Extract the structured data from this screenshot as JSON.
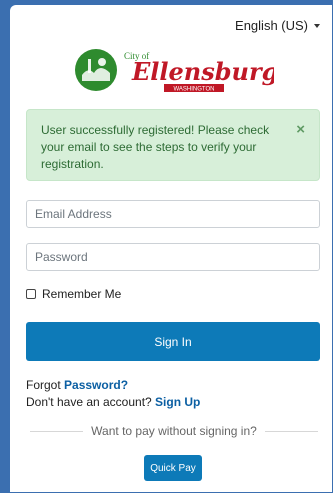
{
  "language": {
    "label": "English (US)"
  },
  "logo": {
    "small_text": "City of",
    "name": "Ellensburg",
    "state": "WASHINGTON",
    "colors": {
      "green": "#2e8b2e",
      "red": "#c01826"
    }
  },
  "alert": {
    "message": "User successfully registered! Please check your email to see the steps to verify your registration.",
    "close_symbol": "×"
  },
  "form": {
    "email_placeholder": "Email Address",
    "password_placeholder": "Password",
    "remember_label": "Remember Me",
    "signin_label": "Sign In"
  },
  "links": {
    "forgot_prefix": "Forgot ",
    "forgot_link": "Password?",
    "signup_prefix": "Don't have an account? ",
    "signup_link": "Sign Up"
  },
  "pay": {
    "divider_text": "Want to pay without signing in?",
    "quickpay_label": "Quick Pay"
  },
  "colors": {
    "primary": "#0d7ab8",
    "background": "#3b6fb0",
    "alert_bg": "#d7efd9",
    "alert_text": "#2d6b34",
    "link": "#0b5fa3"
  }
}
